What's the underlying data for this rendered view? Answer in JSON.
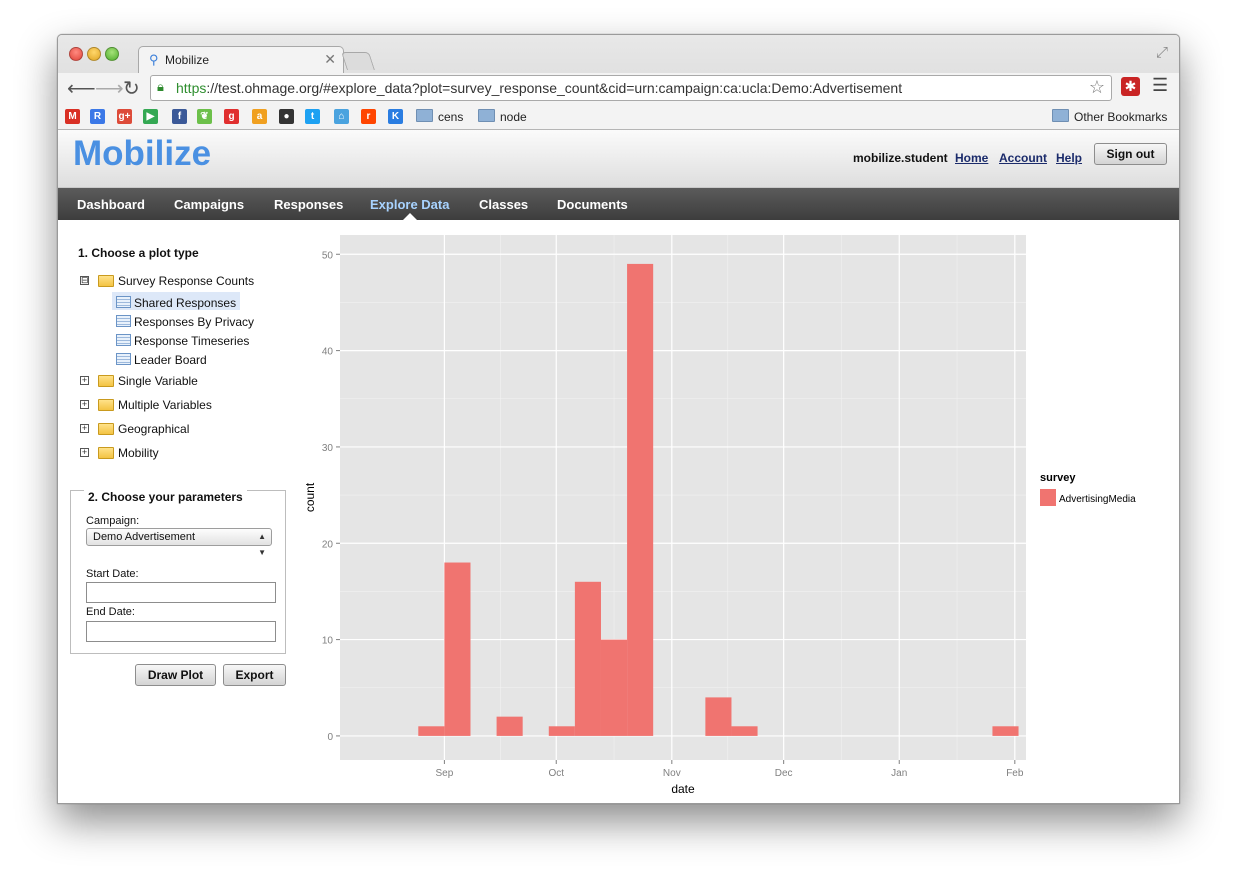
{
  "browser": {
    "tab_title": "Mobilize",
    "url_scheme": "https",
    "url_rest": "://test.ohmage.org/#explore_data?plot=survey_response_count&cid=urn:campaign:ca:ucla:Demo:Advertisement",
    "bookmarks": [
      {
        "icon": "gmail-icon",
        "color": "#d93025",
        "glyph": "M"
      },
      {
        "icon": "reader-icon",
        "color": "#3b78e7",
        "glyph": "R"
      },
      {
        "icon": "google-plus-icon",
        "color": "#dd4b39",
        "glyph": "g+"
      },
      {
        "icon": "play-store-icon",
        "color": "#34a853",
        "glyph": "▶"
      },
      {
        "icon": "facebook-icon",
        "color": "#3b5998",
        "glyph": "f"
      },
      {
        "icon": "leaf-icon",
        "color": "#6cc04a",
        "glyph": "❦"
      },
      {
        "icon": "g-icon",
        "color": "#e02f2f",
        "glyph": "g"
      },
      {
        "icon": "amazon-icon",
        "color": "#f0a020",
        "glyph": "a"
      },
      {
        "icon": "github-icon",
        "color": "#333333",
        "glyph": "●"
      },
      {
        "icon": "twitter-icon",
        "color": "#1da1f2",
        "glyph": "t"
      },
      {
        "icon": "home-icon",
        "color": "#4aa3df",
        "glyph": "⌂"
      },
      {
        "icon": "reddit-icon",
        "color": "#ff4500",
        "glyph": "r"
      },
      {
        "icon": "k-icon",
        "color": "#2a7de1",
        "glyph": "K"
      }
    ],
    "folders": [
      "cens",
      "node"
    ],
    "other_bookmarks": "Other Bookmarks"
  },
  "header": {
    "logo": "Mobilize",
    "username": "mobilize.student",
    "links": [
      "Home",
      "Account",
      "Help"
    ],
    "sign_out": "Sign out"
  },
  "nav": {
    "items": [
      "Dashboard",
      "Campaigns",
      "Responses",
      "Explore Data",
      "Classes",
      "Documents"
    ],
    "active": "Explore Data"
  },
  "sidebar": {
    "step1_title": "1. Choose a plot type",
    "tree": {
      "survey_counts": {
        "label": "Survey Response Counts",
        "toggle": "⊟"
      },
      "children": [
        "Shared Responses",
        "Responses By Privacy",
        "Response Timeseries",
        "Leader Board"
      ],
      "selected": "Shared Responses",
      "groups": [
        "Single Variable",
        "Multiple Variables",
        "Geographical",
        "Mobility"
      ],
      "group_toggle": "+"
    },
    "step2_title": "2. Choose your parameters",
    "campaign_label": "Campaign:",
    "campaign_value": "Demo Advertisement",
    "start_date_label": "Start Date:",
    "start_date_value": "",
    "end_date_label": "End Date:",
    "end_date_value": "",
    "draw_button": "Draw Plot",
    "export_button": "Export"
  },
  "chart_data": {
    "type": "bar",
    "xlabel": "date",
    "ylabel": "count",
    "x_ticks": [
      "Sep",
      "Oct",
      "Nov",
      "Dec",
      "Jan",
      "Feb"
    ],
    "x_tick_dates": [
      "2012-09-01",
      "2012-10-01",
      "2012-11-01",
      "2012-12-01",
      "2013-01-01",
      "2013-02-01"
    ],
    "x_range": [
      "2012-08-04",
      "2013-02-04"
    ],
    "ylim": [
      -2.5,
      52
    ],
    "y_ticks": [
      0,
      10,
      20,
      30,
      40,
      50
    ],
    "bin_days": 7,
    "series": [
      {
        "name": "AdvertisingMedia",
        "color": "#f07470",
        "bars": [
          {
            "start": "2012-08-25",
            "value": 1
          },
          {
            "start": "2012-09-01",
            "value": 18
          },
          {
            "start": "2012-09-15",
            "value": 2
          },
          {
            "start": "2012-09-29",
            "value": 1
          },
          {
            "start": "2012-10-06",
            "value": 16
          },
          {
            "start": "2012-10-13",
            "value": 10
          },
          {
            "start": "2012-10-20",
            "value": 49
          },
          {
            "start": "2012-11-10",
            "value": 4
          },
          {
            "start": "2012-11-17",
            "value": 1
          },
          {
            "start": "2013-01-26",
            "value": 1
          }
        ]
      }
    ],
    "legend_title": "survey",
    "legend_position": "right",
    "grid": true,
    "panel_background": "#e5e5e5"
  }
}
